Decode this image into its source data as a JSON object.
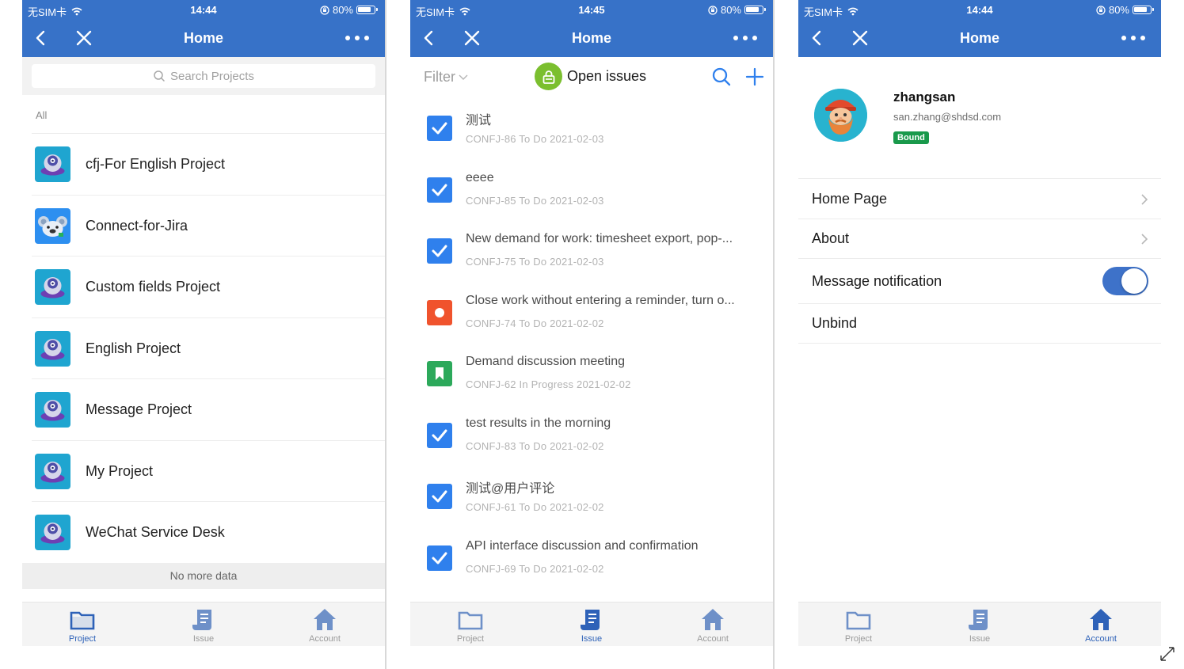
{
  "statusbar": {
    "carrier": "无SIM卡",
    "battery": "80%",
    "screen1_time": "14:44",
    "screen2_time": "14:45",
    "screen3_time": "14:44"
  },
  "navbar": {
    "title": "Home"
  },
  "screen1": {
    "search_placeholder": "Search Projects",
    "section_label": "All",
    "projects": [
      {
        "name": "cfj-For English Project",
        "icon": "ufo-icon"
      },
      {
        "name": "Connect-for-Jira",
        "icon": "koala-icon"
      },
      {
        "name": "Custom fields Project",
        "icon": "ufo-icon"
      },
      {
        "name": "English Project",
        "icon": "ufo-icon"
      },
      {
        "name": "Message Project",
        "icon": "ufo-icon"
      },
      {
        "name": "My Project",
        "icon": "ufo-icon"
      },
      {
        "name": "WeChat Service Desk",
        "icon": "ufo-icon"
      }
    ],
    "no_more": "No more data"
  },
  "screen2": {
    "filter_label": "Filter",
    "open_issues_label": "Open issues",
    "issues": [
      {
        "title": "测试",
        "key": "CONFJ-86",
        "status": "To Do",
        "date": "2021-02-03",
        "type": "task"
      },
      {
        "title": "eeee",
        "key": "CONFJ-85",
        "status": "To Do",
        "date": "2021-02-03",
        "type": "task"
      },
      {
        "title": "New demand for work: timesheet export, pop-...",
        "key": "CONFJ-75",
        "status": "To Do",
        "date": "2021-02-03",
        "type": "task"
      },
      {
        "title": "Close work without entering a reminder, turn o...",
        "key": "CONFJ-74",
        "status": "To Do",
        "date": "2021-02-02",
        "type": "bug"
      },
      {
        "title": "Demand discussion meeting",
        "key": "CONFJ-62",
        "status": "In Progress",
        "date": "2021-02-02",
        "type": "story"
      },
      {
        "title": "test results in the morning",
        "key": "CONFJ-83",
        "status": "To Do",
        "date": "2021-02-02",
        "type": "task"
      },
      {
        "title": "测试@用户评论",
        "key": "CONFJ-61",
        "status": "To Do",
        "date": "2021-02-02",
        "type": "task"
      },
      {
        "title": "API interface discussion and confirmation",
        "key": "CONFJ-69",
        "status": "To Do",
        "date": "2021-02-02",
        "type": "task"
      }
    ]
  },
  "screen3": {
    "username": "zhangsan",
    "email": "san.zhang@shdsd.com",
    "badge": "Bound",
    "settings": {
      "home_page": "Home Page",
      "about": "About",
      "message_notification": "Message notification",
      "notification_enabled": true,
      "unbind": "Unbind"
    }
  },
  "tabs": [
    "Project",
    "Issue",
    "Account"
  ],
  "colors": {
    "primary": "#3772c8",
    "tab_active": "#2e62b8",
    "task": "#2f80ed",
    "bug": "#f0532d",
    "story": "#2ca95b",
    "bound": "#19994b",
    "lock": "#7bbf2f"
  }
}
